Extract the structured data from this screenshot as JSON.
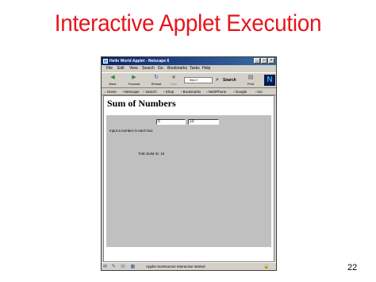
{
  "slide": {
    "title": "Interactive Applet Execution",
    "page_number": "22"
  },
  "window": {
    "title": "Hello World Applet - Netscape 6",
    "controls": {
      "minimize": "_",
      "maximize": "□",
      "close": "×"
    }
  },
  "menu": {
    "items": [
      "File",
      "Edit",
      "View",
      "Search",
      "Go",
      "Bookmarks",
      "Tasks",
      "Help"
    ]
  },
  "navbar": {
    "back": "Back",
    "forward": "Forward",
    "reload": "Reload",
    "stop": "Stop",
    "url": "http://",
    "search": "Search",
    "print": "Print",
    "logo": "N"
  },
  "bookmarks": {
    "items": [
      "Home",
      "Netscape",
      "Search",
      "Shop",
      "Bookmarks",
      "Net2Phone",
      "Google",
      "Go"
    ]
  },
  "content": {
    "heading": "Sum of Numbers",
    "input1_value": "5",
    "input2_value": "10",
    "prompt": "Input a number in each box",
    "result": "THE SUM IS: 15"
  },
  "statusbar": {
    "text": "Applet SumNums2 Interactive started"
  }
}
